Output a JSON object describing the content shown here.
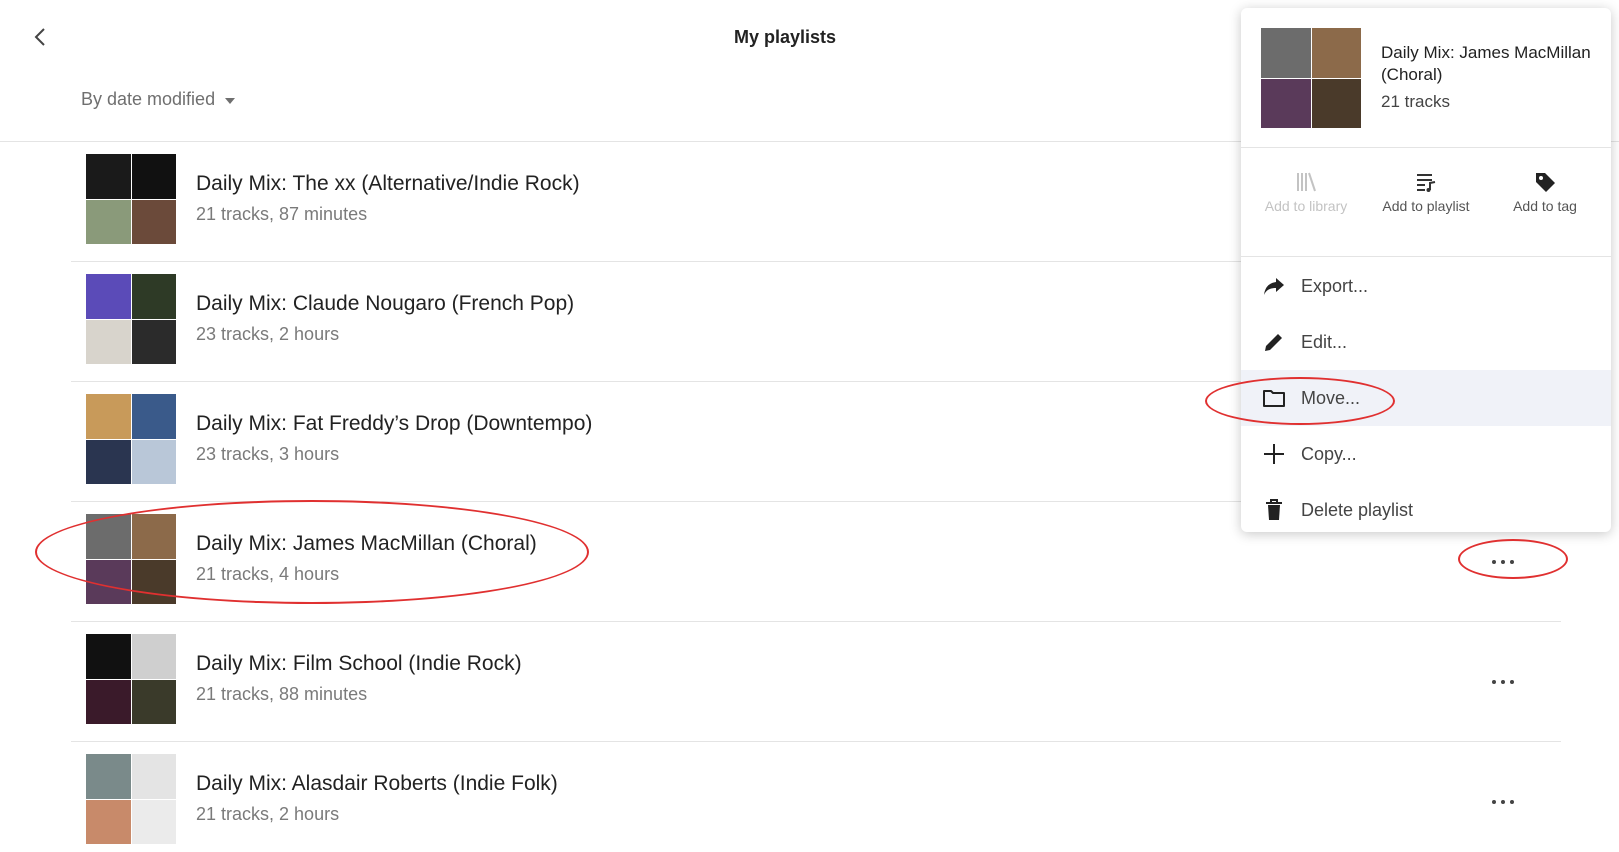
{
  "header": {
    "back_icon": "chevron-left-icon",
    "title": "My playlists",
    "sort_label": "By date modified",
    "sort_icon": "caret-down-icon"
  },
  "playlists": [
    {
      "title": "Daily Mix: The xx (Alternative/Indie Rock)",
      "subtitle": "21 tracks, 87 minutes",
      "cover_colors": [
        "#1a1a1a",
        "#111111",
        "#8a9a7a",
        "#6b4a3a"
      ]
    },
    {
      "title": "Daily Mix: Claude Nougaro (French Pop)",
      "subtitle": "23 tracks, 2 hours",
      "cover_colors": [
        "#5b4bb8",
        "#2e3a26",
        "#d8d4cc",
        "#2b2b2b"
      ]
    },
    {
      "title": "Daily Mix: Fat Freddy’s Drop (Downtempo)",
      "subtitle": "23 tracks, 3 hours",
      "cover_colors": [
        "#c89a5a",
        "#3a5a8a",
        "#2a3550",
        "#b9c7d8"
      ]
    },
    {
      "title": "Daily Mix: James MacMillan (Choral)",
      "subtitle": "21 tracks, 4 hours",
      "cover_colors": [
        "#6c6c6c",
        "#8c6a4a",
        "#5a3a5a",
        "#4a3a2a"
      ]
    },
    {
      "title": "Daily Mix: Film School (Indie Rock)",
      "subtitle": "21 tracks, 88 minutes",
      "cover_colors": [
        "#111111",
        "#cfcfcf",
        "#3a1a2a",
        "#3a3a2a"
      ]
    },
    {
      "title": "Daily Mix: Alasdair Roberts (Indie Folk)",
      "subtitle": "21 tracks, 2 hours",
      "cover_colors": [
        "#7a8a8a",
        "#e4e4e4",
        "#c88a6a",
        "#ebebeb"
      ]
    }
  ],
  "more_icon": "more-horizontal-icon",
  "popup": {
    "title": "Daily Mix: James MacMillan (Choral)",
    "track_count": "21 tracks",
    "cover_colors": [
      "#6c6c6c",
      "#8c6a4a",
      "#5a3a5a",
      "#4a3a2a"
    ],
    "actions": [
      {
        "label": "Add to library",
        "icon": "library-icon",
        "enabled": false
      },
      {
        "label": "Add to playlist",
        "icon": "playlist-add-icon",
        "enabled": true
      },
      {
        "label": "Add to tag",
        "icon": "tag-icon",
        "enabled": true
      }
    ],
    "menu": [
      {
        "label": "Export...",
        "icon": "share-arrow-icon"
      },
      {
        "label": "Edit...",
        "icon": "pencil-icon"
      },
      {
        "label": "Move...",
        "icon": "folder-icon",
        "highlighted": true
      },
      {
        "label": "Copy...",
        "icon": "plus-icon"
      },
      {
        "label": "Delete playlist",
        "icon": "trash-icon"
      }
    ]
  },
  "colors": {
    "annotation_ring": "#e03030",
    "hover_bg": "#f0f2f8",
    "divider": "#e4e4e4"
  }
}
